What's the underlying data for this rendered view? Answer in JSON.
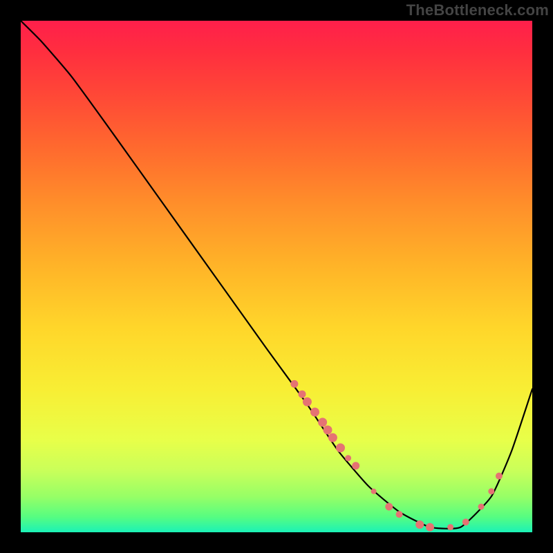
{
  "watermark": "TheBottleneck.com",
  "chart_data": {
    "type": "line",
    "title": "",
    "xlabel": "",
    "ylabel": "",
    "xlim": [
      0,
      100
    ],
    "ylim": [
      0,
      100
    ],
    "grid": false,
    "legend": false,
    "annotations": [],
    "series": [
      {
        "name": "curve",
        "color": "#000000",
        "x": [
          0,
          4,
          10,
          18,
          28,
          38,
          48,
          56,
          62,
          68,
          74,
          80,
          86,
          92,
          96,
          100
        ],
        "values": [
          100,
          96,
          89,
          78,
          64,
          50,
          36,
          25,
          16,
          9,
          4,
          1,
          1,
          7,
          16,
          28
        ]
      }
    ],
    "markers": [
      {
        "x": 53.5,
        "y": 29.0,
        "r": 5.5
      },
      {
        "x": 55.0,
        "y": 27.0,
        "r": 5.5
      },
      {
        "x": 56.0,
        "y": 25.5,
        "r": 6.5
      },
      {
        "x": 57.5,
        "y": 23.5,
        "r": 6.5
      },
      {
        "x": 59.0,
        "y": 21.5,
        "r": 6.5
      },
      {
        "x": 60.0,
        "y": 20.0,
        "r": 6.5
      },
      {
        "x": 61.0,
        "y": 18.5,
        "r": 6.5
      },
      {
        "x": 62.5,
        "y": 16.5,
        "r": 6.5
      },
      {
        "x": 64.0,
        "y": 14.5,
        "r": 4.5
      },
      {
        "x": 65.5,
        "y": 13.0,
        "r": 5.5
      },
      {
        "x": 69.0,
        "y": 8.0,
        "r": 4.0
      },
      {
        "x": 72.0,
        "y": 5.0,
        "r": 5.5
      },
      {
        "x": 74.0,
        "y": 3.5,
        "r": 5.0
      },
      {
        "x": 78.0,
        "y": 1.5,
        "r": 6.0
      },
      {
        "x": 80.0,
        "y": 1.0,
        "r": 6.0
      },
      {
        "x": 84.0,
        "y": 1.0,
        "r": 4.5
      },
      {
        "x": 87.0,
        "y": 2.0,
        "r": 5.0
      },
      {
        "x": 90.0,
        "y": 5.0,
        "r": 4.5
      },
      {
        "x": 92.0,
        "y": 8.0,
        "r": 4.5
      },
      {
        "x": 93.5,
        "y": 11.0,
        "r": 5.0
      }
    ],
    "marker_color": "#e57373"
  }
}
